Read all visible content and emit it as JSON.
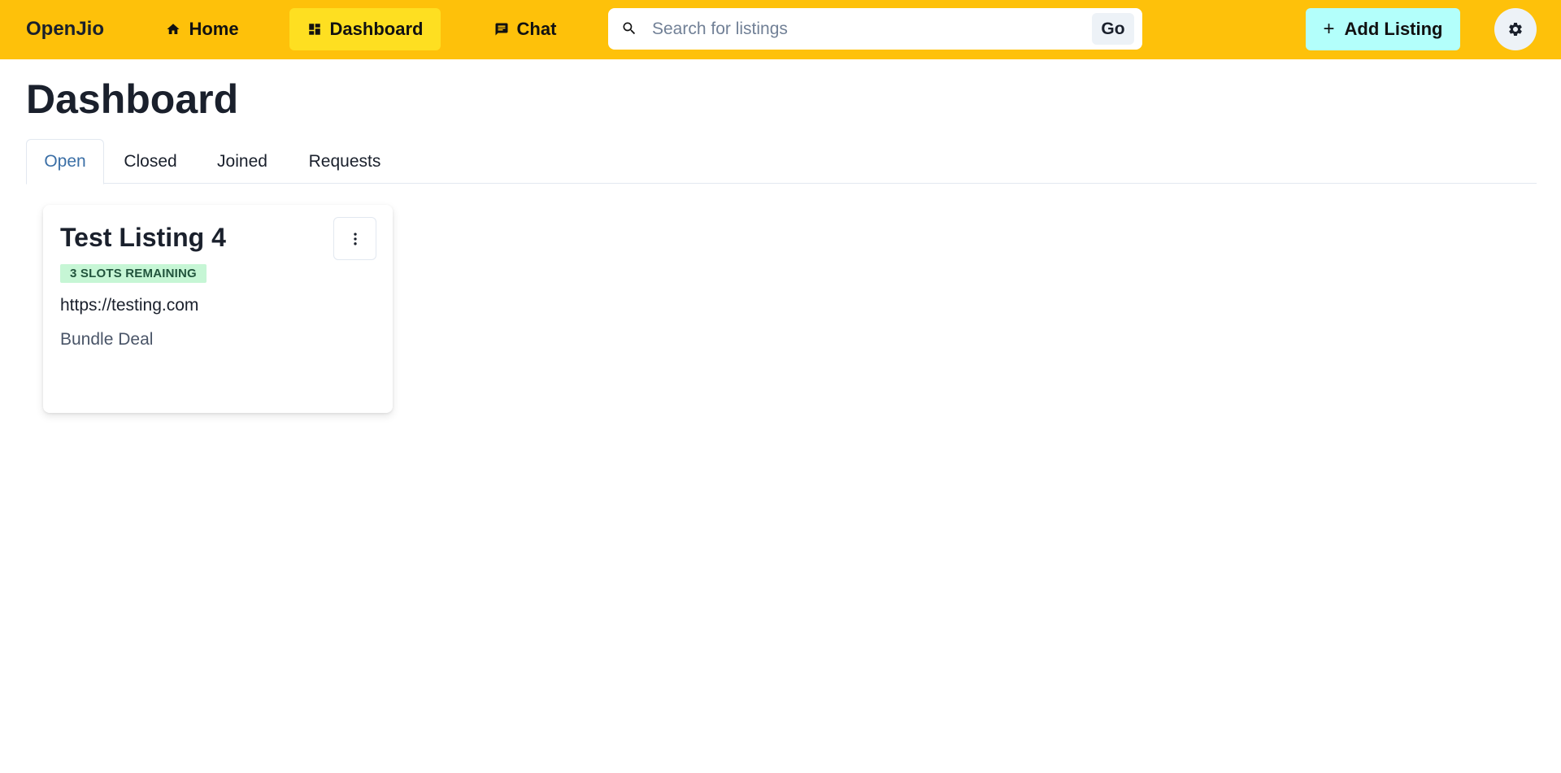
{
  "navbar": {
    "brand": "OpenJio",
    "items": [
      {
        "label": "Home",
        "icon": "home-icon"
      },
      {
        "label": "Dashboard",
        "icon": "dashboard-icon",
        "active": true
      },
      {
        "label": "Chat",
        "icon": "chat-icon"
      }
    ],
    "search": {
      "placeholder": "Search for listings",
      "value": "",
      "button_label": "Go"
    },
    "add_listing_label": "Add Listing",
    "settings_icon": "gear-icon",
    "colors": {
      "navbar_bg": "#fec10a",
      "active_nav_bg": "#fedf21",
      "add_listing_bg": "#b3fffb"
    }
  },
  "page": {
    "title": "Dashboard",
    "tabs": [
      {
        "label": "Open",
        "active": true
      },
      {
        "label": "Closed"
      },
      {
        "label": "Joined"
      },
      {
        "label": "Requests"
      }
    ]
  },
  "listings": [
    {
      "title": "Test Listing 4",
      "badge": "3 SLOTS REMAINING",
      "link": "https://testing.com",
      "subtitle": "Bundle Deal",
      "menu_icon": "more-vertical-icon"
    }
  ]
}
